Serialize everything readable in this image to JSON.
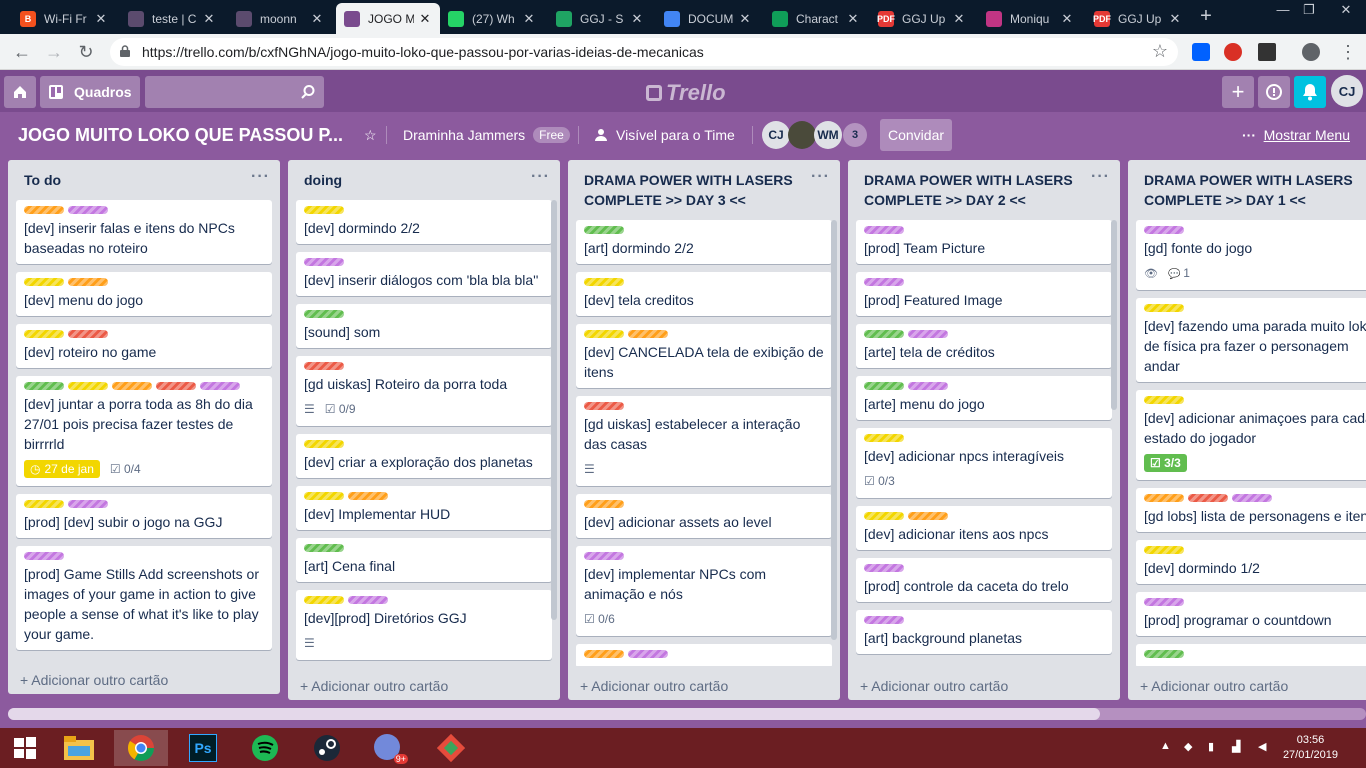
{
  "browser": {
    "tabs": [
      {
        "title": "Wi-Fi Fr",
        "color": "#f4511e",
        "glyph": "B",
        "active": false
      },
      {
        "title": "teste | C",
        "color": "#5b4b6e",
        "glyph": "",
        "active": false
      },
      {
        "title": "moonn",
        "color": "#5b4b6e",
        "glyph": "",
        "active": false
      },
      {
        "title": "JOGO M",
        "color": "#7a4b8e",
        "glyph": "",
        "active": true
      },
      {
        "title": "(27) Wh",
        "color": "#25d366",
        "glyph": "",
        "active": false
      },
      {
        "title": "GGJ - S",
        "color": "#1fa463",
        "glyph": "",
        "active": false
      },
      {
        "title": "DOCUM",
        "color": "#4285f4",
        "glyph": "",
        "active": false
      },
      {
        "title": "Charact",
        "color": "#0f9d58",
        "glyph": "",
        "active": false
      },
      {
        "title": "GGJ Up",
        "color": "#e53935",
        "glyph": "PDF",
        "active": false
      },
      {
        "title": "Moniqu",
        "color": "#c13584",
        "glyph": "",
        "active": false
      },
      {
        "title": "GGJ Up",
        "color": "#e53935",
        "glyph": "PDF",
        "active": false
      }
    ],
    "new_tab": "+",
    "url": "https://trello.com/b/cxfNGhNA/jogo-muito-loko-que-passou-por-varias-ideias-de-mecanicas"
  },
  "header": {
    "boards_label": "Quadros",
    "logo": "Trello",
    "avatar": "CJ"
  },
  "board": {
    "title": "JOGO MUITO LOKO QUE PASSOU P...",
    "team": "Draminha Jammers",
    "team_badge": "Free",
    "visibility": "Visível para o Time",
    "members": [
      "CJ",
      "",
      "WM"
    ],
    "member_count": "3",
    "invite": "Convidar",
    "show_menu": "Mostrar Menu"
  },
  "add_card": "+ Adicionar outro cartão",
  "lists": [
    {
      "title": "To do",
      "cards": [
        {
          "labels": [
            "orange",
            "purple"
          ],
          "title": "[dev] inserir falas e itens do NPCs baseadas no roteiro"
        },
        {
          "labels": [
            "yellow",
            "orange"
          ],
          "title": "[dev] menu do jogo"
        },
        {
          "labels": [
            "yellow",
            "red"
          ],
          "title": "[dev] roteiro no game"
        },
        {
          "labels": [
            "green",
            "yellow",
            "orange",
            "red",
            "purple"
          ],
          "title": "[dev] juntar a porra toda as 8h do dia 27/01 pois precisa fazer testes de birrrrld",
          "due": "27 de jan",
          "checklist": "0/4"
        },
        {
          "labels": [
            "yellow",
            "purple"
          ],
          "title": "[prod] [dev] subir o jogo na GGJ"
        },
        {
          "labels": [
            "purple"
          ],
          "title": "[prod] Game Stills Add screenshots or images of your game in action to give people a sense of what it's like to play your game."
        }
      ]
    },
    {
      "title": "doing",
      "cards": [
        {
          "labels": [
            "yellow"
          ],
          "title": "[dev] dormindo 2/2"
        },
        {
          "labels": [
            "purple"
          ],
          "title": "[dev] inserir diálogos com 'bla bla bla''"
        },
        {
          "labels": [
            "green"
          ],
          "title": "[sound] som"
        },
        {
          "labels": [
            "red"
          ],
          "title": "[gd uiskas] Roteiro da porra toda",
          "desc": true,
          "checklist": "0/9"
        },
        {
          "labels": [
            "yellow"
          ],
          "title": "[dev] criar a exploração dos planetas"
        },
        {
          "labels": [
            "yellow",
            "orange"
          ],
          "title": "[dev] Implementar HUD"
        },
        {
          "labels": [
            "green"
          ],
          "title": "[art] Cena final"
        },
        {
          "labels": [
            "yellow",
            "purple"
          ],
          "title": "[dev][prod] Diretórios GGJ",
          "desc": true
        }
      ]
    },
    {
      "title": "DRAMA POWER WITH LASERS COMPLETE >> DAY 3 <<",
      "cards": [
        {
          "labels": [
            "green"
          ],
          "title": "[art] dormindo 2/2"
        },
        {
          "labels": [
            "yellow"
          ],
          "title": "[dev] tela creditos"
        },
        {
          "labels": [
            "yellow",
            "orange"
          ],
          "title": "[dev] CANCELADA tela de exibição de itens"
        },
        {
          "labels": [
            "red"
          ],
          "title": "[gd uiskas] estabelecer a interação das casas",
          "desc": true
        },
        {
          "labels": [
            "orange"
          ],
          "title": "[dev] adicionar assets ao level"
        },
        {
          "labels": [
            "purple"
          ],
          "title": "[dev] implementar NPCs com animação e nós",
          "checklist": "0/6"
        },
        {
          "labels": [
            "orange",
            "purple"
          ],
          "title": ""
        }
      ]
    },
    {
      "title": "DRAMA POWER WITH LASERS COMPLETE >> DAY 2 <<",
      "cards": [
        {
          "labels": [
            "purple"
          ],
          "title": "[prod] Team Picture"
        },
        {
          "labels": [
            "purple"
          ],
          "title": "[prod] Featured Image"
        },
        {
          "labels": [
            "green",
            "purple"
          ],
          "title": "[arte] tela de créditos"
        },
        {
          "labels": [
            "green",
            "purple"
          ],
          "title": "[arte] menu do jogo"
        },
        {
          "labels": [
            "yellow"
          ],
          "title": "[dev] adicionar npcs interagíveis",
          "checklist": "0/3"
        },
        {
          "labels": [
            "yellow",
            "orange"
          ],
          "title": "[dev] adicionar itens aos npcs"
        },
        {
          "labels": [
            "purple"
          ],
          "title": "[prod] controle da caceta do trelo"
        },
        {
          "labels": [
            "purple"
          ],
          "title": "[art] background planetas"
        }
      ]
    },
    {
      "title": "DRAMA POWER WITH LASERS COMPLETE >> DAY 1 <<",
      "cards": [
        {
          "labels": [
            "purple"
          ],
          "title": "[gd] fonte do jogo",
          "watch": true,
          "comments": "1"
        },
        {
          "labels": [
            "yellow"
          ],
          "title": "[dev] fazendo uma parada muito loka de física pra fazer o personagem andar"
        },
        {
          "labels": [
            "yellow"
          ],
          "title": "[dev] adicionar animaçoes para cada estado do jogador",
          "checklist_done": "3/3"
        },
        {
          "labels": [
            "orange",
            "red",
            "purple"
          ],
          "title": "[gd lobs] lista de personagens e itens"
        },
        {
          "labels": [
            "yellow"
          ],
          "title": "[dev] dormindo 1/2"
        },
        {
          "labels": [
            "purple"
          ],
          "title": "[prod] programar o countdown"
        },
        {
          "labels": [
            "green"
          ],
          "title": ""
        }
      ]
    }
  ],
  "taskbar": {
    "apps": [
      "windows-start",
      "file-explorer",
      "chrome",
      "photoshop",
      "spotify",
      "steam",
      "discord",
      "game-app"
    ],
    "discord_badge": "9+",
    "time": "03:56",
    "date": "27/01/2019"
  }
}
